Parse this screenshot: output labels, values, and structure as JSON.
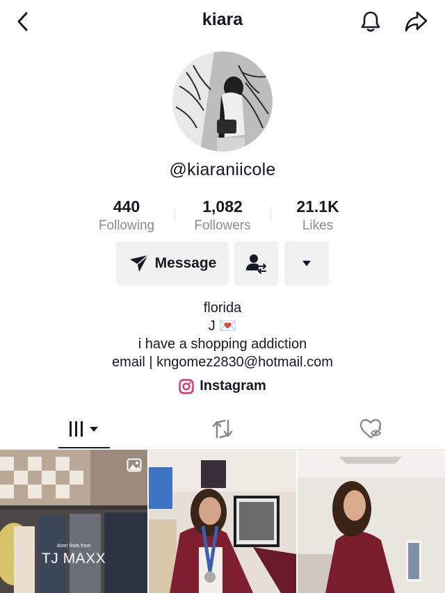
{
  "header": {
    "title": "kiara",
    "back_icon": "chevron-left-icon",
    "bell_icon": "bell-icon",
    "share_icon": "share-icon"
  },
  "profile": {
    "username": "@kiaraniicole",
    "stats": [
      {
        "value": "440",
        "label": "Following"
      },
      {
        "value": "1,082",
        "label": "Followers"
      },
      {
        "value": "21.1K",
        "label": "Likes"
      }
    ],
    "message_label": "Message",
    "bio": [
      "florida",
      "J 💌",
      "i have a shopping addiction",
      "email | kngomez2830@hotmail.com"
    ],
    "link_label": "Instagram"
  },
  "tabs": [
    "videos-grid",
    "reposts",
    "liked-private"
  ],
  "grid": {
    "items": [
      {
        "small_text": "dorm finds from",
        "big_text": "TJ MAXX"
      },
      {},
      {}
    ]
  },
  "colors": {
    "text": "#161823",
    "secondary": "#8a8b91",
    "button_bg": "#f1f1f2",
    "instagram": "#e1306c"
  }
}
